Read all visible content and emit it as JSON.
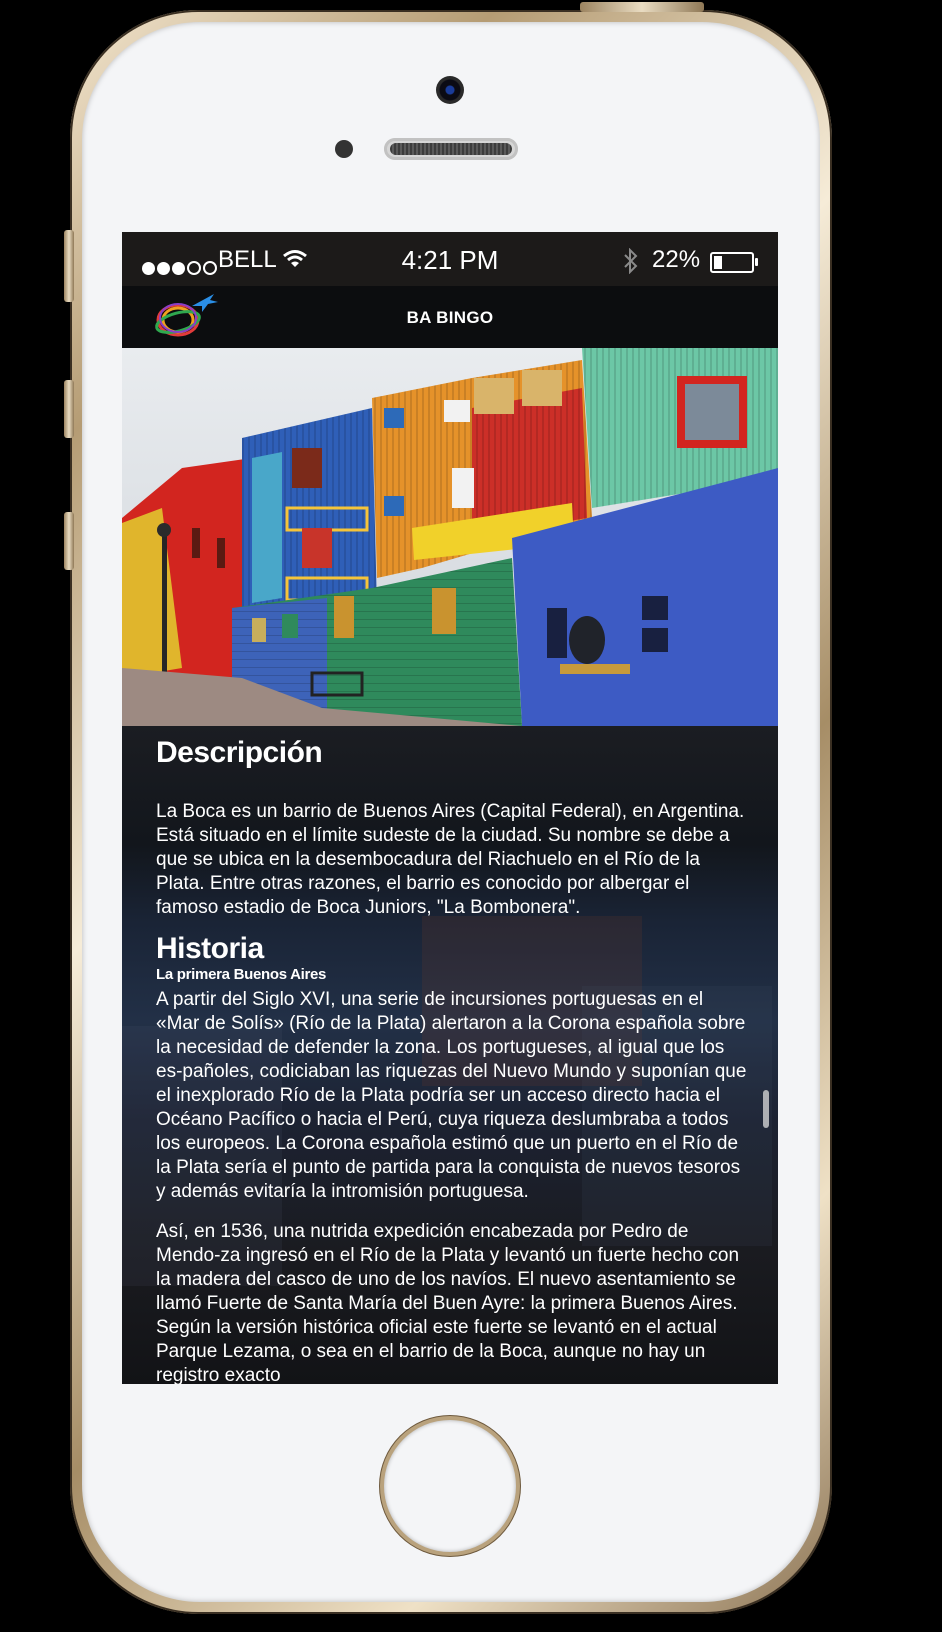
{
  "status_bar": {
    "carrier": "BELL",
    "time": "4:21 PM",
    "battery_percent": "22%",
    "battery_level": 0.22,
    "signal_bars_filled": 3,
    "signal_bars_total": 5
  },
  "nav": {
    "title": "BA BINGO",
    "logo_icon": "globe-airplane-logo-icon"
  },
  "article": {
    "description_heading": "Descripción",
    "description_text": "La Boca es un barrio de Buenos Aires (Capital Federal), en Argentina. Está situado en el límite sudeste de la ciudad. Su nombre se debe a que se ubica en la desembocadura del Riachuelo en el Río de la Plata. Entre otras razones, el barrio es conocido por albergar el famoso estadio de Boca Juniors, \"La Bombonera\".",
    "history_heading": "Historia",
    "history_subheading": "La primera Buenos Aires",
    "history_paragraph_1": "A partir del Siglo XVI, una serie de incursiones portuguesas en el «Mar de Solís» (Río de la Plata) alertaron a la Corona española sobre la necesidad de defender la zona. Los portugueses, al igual que los es-pañoles, codiciaban las riquezas del Nuevo Mundo y suponían que el inexplorado Río de la Plata podría ser un acceso directo hacia el Océano Pacífico o hacia el Perú, cuya riqueza deslumbraba a todos los europeos. La Corona española estimó que un puerto en el Río de la Plata sería el punto de partida para la conquista de nuevos tesoros y además evitaría la intromisión portuguesa.",
    "history_paragraph_2": "Así, en 1536, una nutrida expedición encabezada por Pedro de Mendo-za ingresó en el Río de la Plata y levantó un fuerte hecho con la madera del casco de uno de los navíos. El nuevo asentamiento se llamó Fuerte de Santa María del Buen Ayre: la primera Buenos Aires. Según la versión histórica oficial este fuerte se levantó en el actual Parque Lezama, o sea en el barrio de la Boca, aunque no hay un registro exacto"
  },
  "colors": {
    "status_bar_bg": "#1c1a19",
    "nav_bar_bg": "#0c0d0f",
    "phone_frame": "#b59c74",
    "text": "#ffffff"
  }
}
